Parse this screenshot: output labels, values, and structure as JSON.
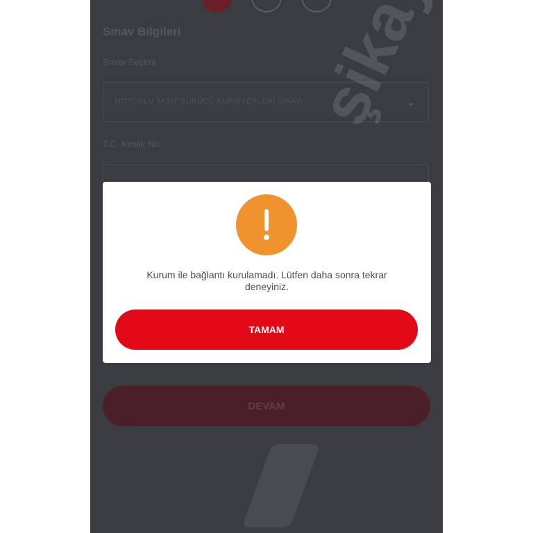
{
  "form": {
    "section_title": "Sınav Bilgileri",
    "exam_select_label": "Sınav Seçimi",
    "exam_select_value": "MOTORLU TAŞIT SÜRÜCÜ KURSİYERLERİ SINAVI",
    "id_label": "T.C. Kimlik No",
    "continue_label": "DEVAM"
  },
  "dialog": {
    "message": "Kurum ile bağlantı kurulamadı. Lütfen daha sonra tekrar deneyiniz.",
    "ok_label": "TAMAM",
    "icon_glyph": "!"
  },
  "watermark": {
    "text": "şikayetvar"
  },
  "colors": {
    "accent": "#e30a17",
    "warning": "#f0922d",
    "overlay": "#3a3c41"
  }
}
